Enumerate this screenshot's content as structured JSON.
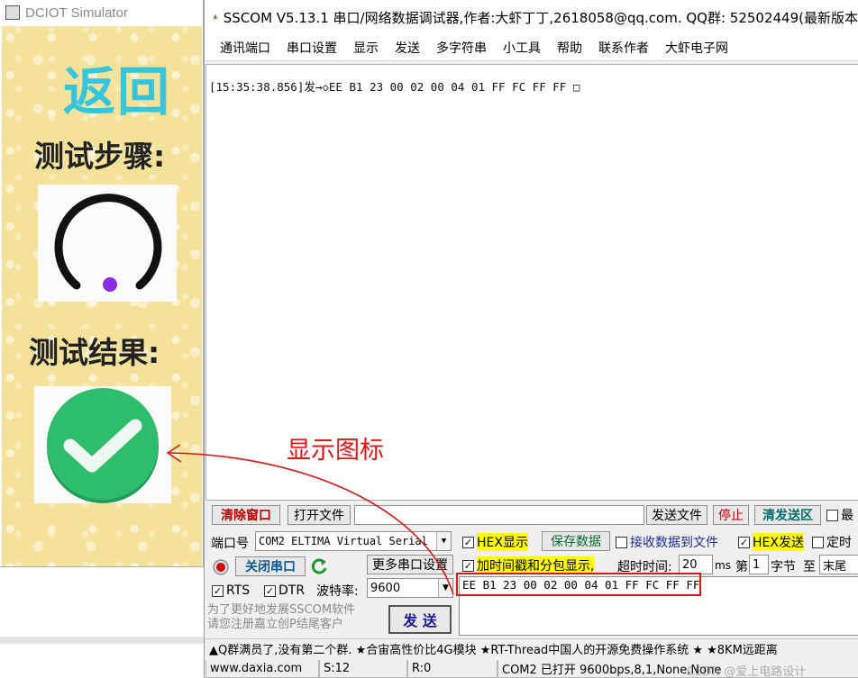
{
  "dciot": {
    "title": "DCIOT Simulator",
    "back_label": "返回",
    "step_label": "测试步骤:",
    "result_label": "测试结果:",
    "icons": {
      "loading": "loading-spinner-icon",
      "result": "green-check-icon"
    },
    "colors": {
      "back": "#35c5dc",
      "spinner": "#111111",
      "dot": "#8a2be2",
      "check_bg": "#2ebd6b",
      "screen_bg": "#f5e29a"
    }
  },
  "sscom": {
    "title": "SSCOM V5.13.1 串口/网络数据调试器,作者:大虾丁丁,2618058@qq.com. QQ群: 52502449(最新版本",
    "menu": [
      "通讯端口",
      "串口设置",
      "显示",
      "发送",
      "多字符串",
      "小工具",
      "帮助",
      "联系作者",
      "大虾电子网"
    ],
    "receive_line": "[15:35:38.856]发→◇EE B1 23 00 02 00 04 01 FF FC FF FF □",
    "row1": {
      "clear_window": "清除窗口",
      "open_file": "打开文件",
      "send_file": "发送文件",
      "stop": "停止",
      "clear_send": "清发送区",
      "last_cb": "最"
    },
    "row2": {
      "port_label": "端口号",
      "port_value": "COM2 ELTIMA Virtual Serial",
      "hex_display": "HEX显示",
      "hex_display_checked": true,
      "save_data": "保存数据",
      "recv_to_file": "接收数据到文件",
      "recv_to_file_checked": false,
      "hex_send": "HEX发送",
      "hex_send_checked": true,
      "timed": "定时",
      "timed_checked": false
    },
    "row3": {
      "close_port": "关闭串口",
      "more_settings": "更多串口设置",
      "timestamp": "加时间戳和分包显示,",
      "timestamp_checked": true,
      "timeout_label": "超时时间:",
      "timeout_value": "20",
      "timeout_unit": "ms",
      "nth_label": "第",
      "nth_value": "1",
      "byte_label": "字节",
      "to_label": "至",
      "end_value": "末尾"
    },
    "row4": {
      "rts": "RTS",
      "rts_checked": true,
      "dtr": "DTR",
      "dtr_checked": true,
      "baud_label": "波特率:",
      "baud_value": "9600",
      "send_data": "EE B1 23 00 02 00 04 01 FF FC FF FF"
    },
    "promo": "为了更好地发展SSCOM软件\n请您注册嘉立创P结尾客户",
    "send_button": "发  送",
    "ticker": "▲Q群满员了,没有第二个群. ★合宙高性价比4G模块 ★RT-Thread中国人的开源免费操作系统 ★ ★8KM远距离",
    "status": {
      "site": "www.daxia.com",
      "sent": "S:12",
      "received": "R:0",
      "port_state": "COM2 已打开  9600bps,8,1,None,None"
    },
    "colors": {
      "highlight": "#ffff00",
      "send_text": "#1a1a9a",
      "annotation": "#e01818"
    }
  },
  "annotation": {
    "text": "显示图标",
    "watermark": "CSDN @爱上电路设计"
  }
}
